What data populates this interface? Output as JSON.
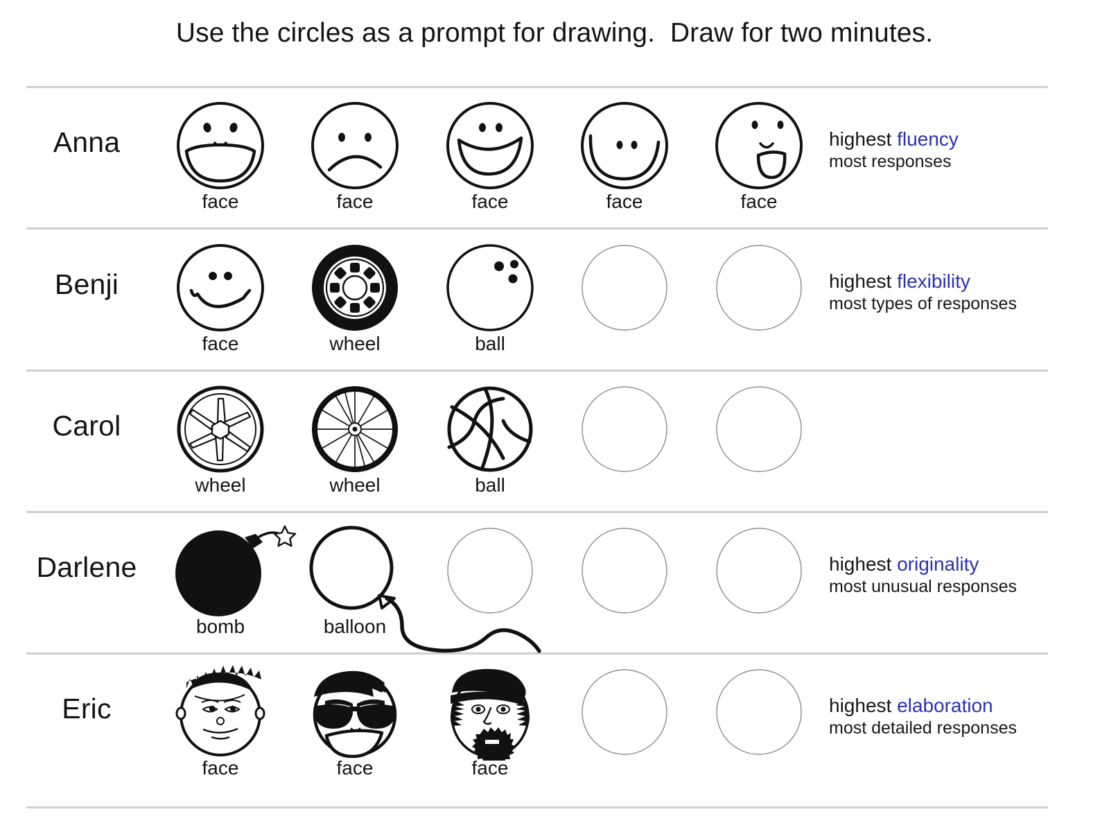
{
  "title": "Use the circles as a prompt for drawing.  Draw for two minutes.",
  "accent_color": "#2b30b0",
  "separator_color": "#cfcfcf",
  "empty_circle_color": "#8c8c8c",
  "rows": [
    {
      "name": "Anna",
      "drawings": [
        {
          "label": "face",
          "kind": "face-open-smile"
        },
        {
          "label": "face",
          "kind": "face-frown"
        },
        {
          "label": "face",
          "kind": "face-grin"
        },
        {
          "label": "face",
          "kind": "face-big-u-smile"
        },
        {
          "label": "face",
          "kind": "face-open-mouth"
        }
      ],
      "empty_count": 0,
      "note": {
        "prefix": "highest ",
        "highlight": "fluency",
        "subtitle": "most responses"
      }
    },
    {
      "name": "Benji",
      "drawings": [
        {
          "label": "face",
          "kind": "face-smiley"
        },
        {
          "label": "wheel",
          "kind": "tire-wheel"
        },
        {
          "label": "ball",
          "kind": "bowling-ball"
        }
      ],
      "empty_count": 2,
      "note": {
        "prefix": "highest ",
        "highlight": "flexibility",
        "subtitle": "most types of responses"
      }
    },
    {
      "name": "Carol",
      "drawings": [
        {
          "label": "wheel",
          "kind": "wagon-wheel"
        },
        {
          "label": "wheel",
          "kind": "bicycle-wheel"
        },
        {
          "label": "ball",
          "kind": "basketball"
        }
      ],
      "empty_count": 2,
      "note": null
    },
    {
      "name": "Darlene",
      "drawings": [
        {
          "label": "bomb",
          "kind": "bomb"
        },
        {
          "label": "balloon",
          "kind": "balloon"
        }
      ],
      "empty_count": 3,
      "note": {
        "prefix": "highest ",
        "highlight": "originality",
        "subtitle": "most unusual responses"
      }
    },
    {
      "name": "Eric",
      "drawings": [
        {
          "label": "face",
          "kind": "face-spiky-hair"
        },
        {
          "label": "face",
          "kind": "face-sunglasses"
        },
        {
          "label": "face",
          "kind": "face-bearded-cap"
        }
      ],
      "empty_count": 2,
      "note": {
        "prefix": "highest ",
        "highlight": "elaboration",
        "subtitle": "most detailed responses"
      }
    }
  ],
  "column_centers": [
    318,
    512,
    707,
    901,
    1095
  ]
}
